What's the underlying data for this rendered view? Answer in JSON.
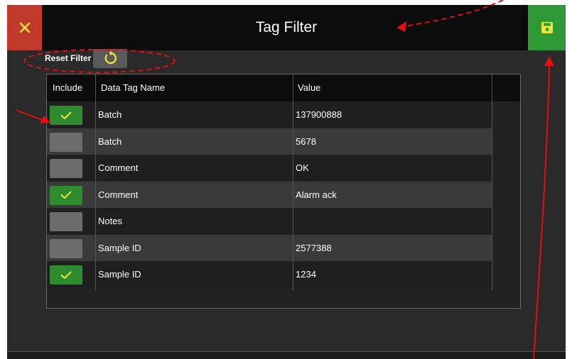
{
  "header": {
    "title": "Tag Filter"
  },
  "toolbar": {
    "close_icon": "close-icon",
    "save_icon": "save-icon"
  },
  "reset": {
    "label": "Reset Filter",
    "icon": "reset-icon"
  },
  "table": {
    "columns": [
      "Include",
      "Data Tag Name",
      "Value"
    ],
    "rows": [
      {
        "include": true,
        "name": "Batch",
        "value": "137900888"
      },
      {
        "include": false,
        "name": "Batch",
        "value": "5678"
      },
      {
        "include": false,
        "name": "Comment",
        "value": "OK"
      },
      {
        "include": true,
        "name": "Comment",
        "value": "Alarm ack"
      },
      {
        "include": false,
        "name": "Notes",
        "value": ""
      },
      {
        "include": false,
        "name": "Sample ID",
        "value": "2577388"
      },
      {
        "include": true,
        "name": "Sample ID",
        "value": "1234"
      }
    ]
  },
  "colors": {
    "close_bg": "#c0392b",
    "save_bg": "#2e9a35",
    "check_on": "#2e8b30",
    "check_off": "#6c6c6c",
    "check_mark": "#f2e23a",
    "annotation": "#e01010"
  }
}
